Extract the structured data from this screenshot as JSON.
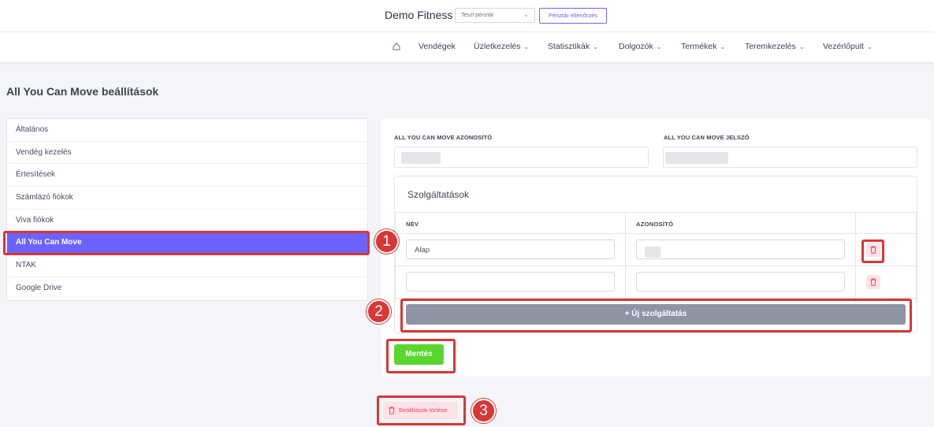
{
  "header": {
    "brand": "Demo Fitness",
    "register_select": "Teszt pénztár",
    "register_check_button": "Pénztár ellenőrzés"
  },
  "nav": {
    "items": [
      {
        "label": "Vendégek",
        "has_dropdown": false
      },
      {
        "label": "Üzletkezelés",
        "has_dropdown": true
      },
      {
        "label": "Statisztikák",
        "has_dropdown": true
      },
      {
        "label": "Dolgozók",
        "has_dropdown": true
      },
      {
        "label": "Termékek",
        "has_dropdown": true
      },
      {
        "label": "Teremkezelés",
        "has_dropdown": true
      },
      {
        "label": "Vezérlőpult",
        "has_dropdown": true
      }
    ]
  },
  "page": {
    "title": "All You Can Move beállítások"
  },
  "menu": {
    "items": [
      {
        "label": "Általános"
      },
      {
        "label": "Vendég kezelés"
      },
      {
        "label": "Értesítések"
      },
      {
        "label": "Számlázó fiókok"
      },
      {
        "label": "Viva fiókok"
      },
      {
        "label": "All You Can Move",
        "active": true
      },
      {
        "label": "NTAK"
      },
      {
        "label": "Google Drive"
      }
    ]
  },
  "form": {
    "id_label": "ALL YOU CAN MOVE AZONOSÍTÓ",
    "password_label": "ALL YOU CAN MOVE JELSZÓ",
    "services_title": "Szolgáltatások",
    "col_name": "NÉV",
    "col_id": "AZONOSÍTÓ",
    "rows": [
      {
        "name": "Alap"
      },
      {
        "name": ""
      }
    ],
    "add_service_button": "+ Új szolgáltatás",
    "save_button": "Mentés"
  },
  "delete_settings_button": "Beállítások törlése",
  "annotations": [
    "1",
    "2",
    "3"
  ],
  "colors": {
    "accent": "#6c63ff",
    "save": "#5bd62f",
    "danger": "#f1416c",
    "annotation": "#d93636",
    "add_button": "#8d95a5"
  }
}
